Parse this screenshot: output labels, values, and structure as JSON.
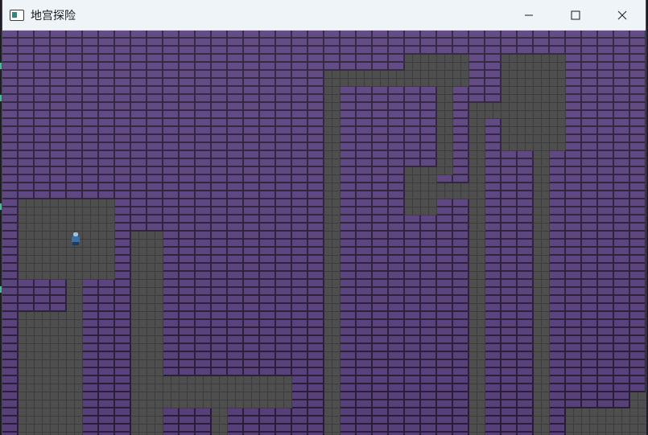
{
  "window": {
    "title": "地宫探险",
    "minimize_glyph": "minimize",
    "maximize_glyph": "maximize",
    "close_glyph": "close"
  },
  "colors": {
    "brick": "#5b4280",
    "mortar": "#2a1f3a",
    "stone": "#4e4e4e",
    "titlebar": "#eff4f9"
  },
  "icons": {
    "app": "app-window-icon",
    "minimize": "minimize-icon",
    "maximize": "maximize-icon",
    "close": "close-icon",
    "player": "player-sprite"
  }
}
